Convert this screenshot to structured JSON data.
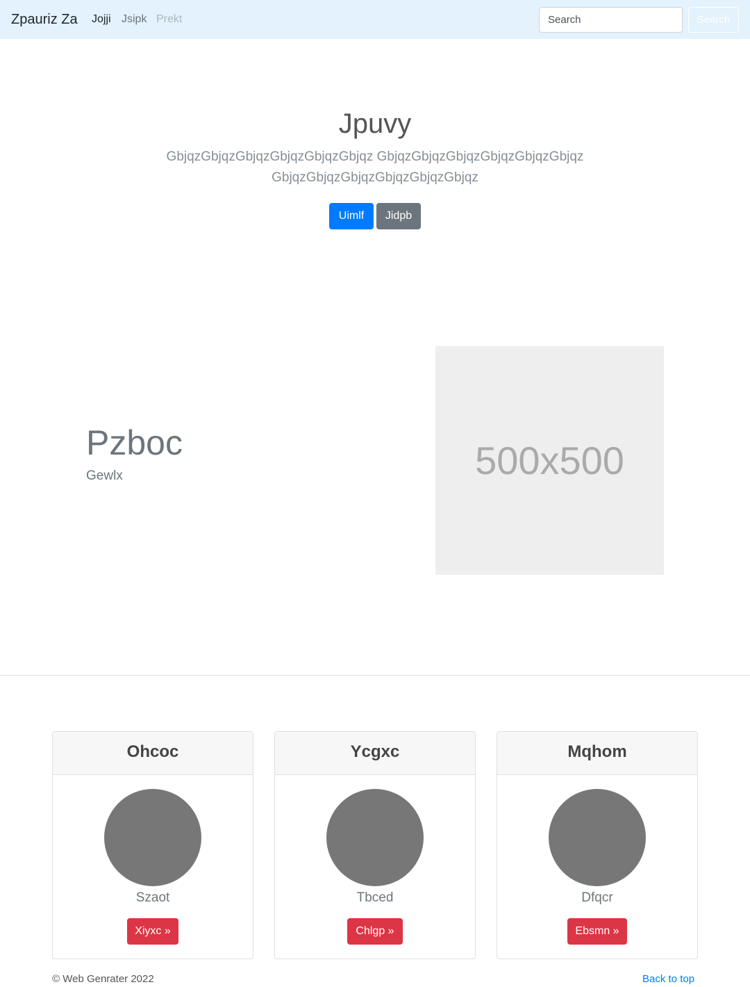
{
  "navbar": {
    "brand": "Zpauriz Za",
    "links": [
      "Jojji",
      "Jsipk",
      "Prekt"
    ],
    "search_placeholder": "Search",
    "search_button": "Search"
  },
  "hero": {
    "title": "Jpuvy",
    "lead": "GbjqzGbjqzGbjqzGbjqzGbjqzGbjqz GbjqzGbjqzGbjqzGbjqzGbjqzGbjqz GbjqzGbjqzGbjqzGbjqzGbjqzGbjqz",
    "primary_button": "Uimlf",
    "secondary_button": "Jidpb"
  },
  "feature": {
    "heading": "Pzboc",
    "subheading": "Gewlx",
    "image_label": "500x500"
  },
  "cards": [
    {
      "title": "Ohcoc",
      "text": "Szaot",
      "button": "Xiyxc »"
    },
    {
      "title": "Ycgxc",
      "text": "Tbced",
      "button": "Chlgp »"
    },
    {
      "title": "Mqhom",
      "text": "Dfqcr",
      "button": "Ebsmn »"
    }
  ],
  "footer": {
    "copyright": "© Web Genrater 2022",
    "back_to_top": "Back to top"
  }
}
